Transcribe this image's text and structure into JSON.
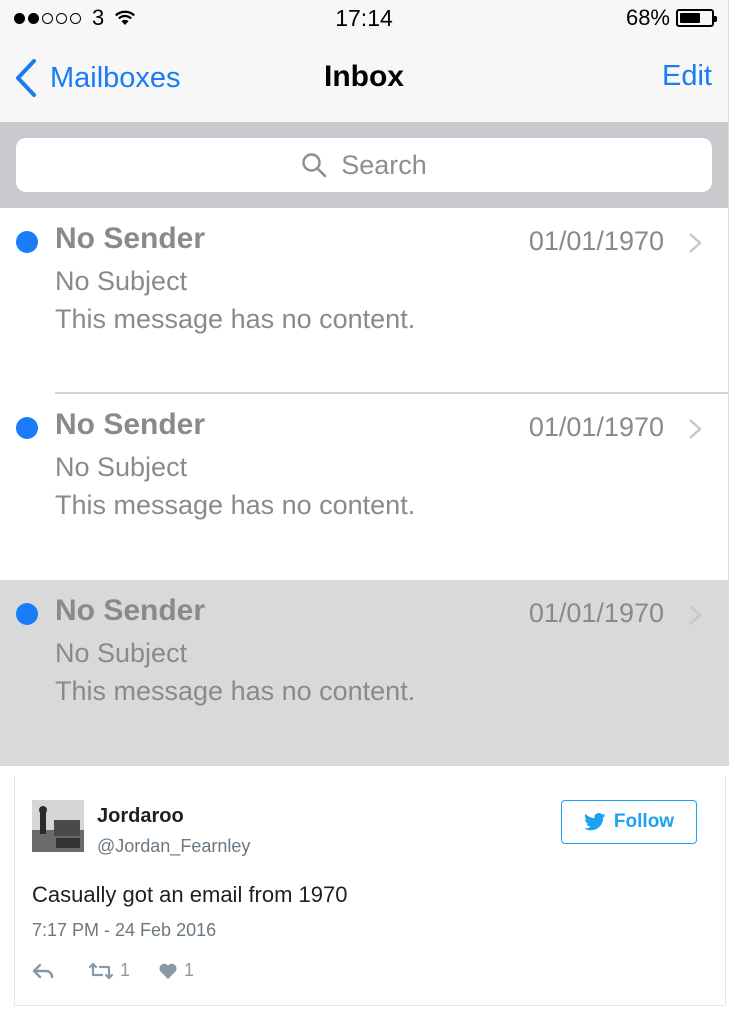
{
  "status_bar": {
    "carrier": "3",
    "time": "17:14",
    "battery": "68%",
    "battery_level": 0.68
  },
  "nav": {
    "back_label": "Mailboxes",
    "title": "Inbox",
    "edit_label": "Edit"
  },
  "search": {
    "placeholder": "Search"
  },
  "messages": [
    {
      "sender": "No Sender",
      "date": "01/01/1970",
      "subject": "No Subject",
      "preview": "This message has no content."
    },
    {
      "sender": "No Sender",
      "date": "01/01/1970",
      "subject": "No Subject",
      "preview": "This message has no content."
    },
    {
      "sender": "No Sender",
      "date": "01/01/1970",
      "subject": "No Subject",
      "preview": "This message has no content."
    }
  ],
  "tweet": {
    "name": "Jordaroo",
    "handle": "@Jordan_Fearnley",
    "follow_label": "Follow",
    "text": "Casually got an email from 1970",
    "timestamp": "7:17 PM - 24 Feb 2016",
    "retweets": "1",
    "likes": "1"
  },
  "colors": {
    "ios_blue": "#1b7cf2",
    "unread_dot": "#1a7cf6",
    "twitter_blue": "#1da1f2"
  }
}
